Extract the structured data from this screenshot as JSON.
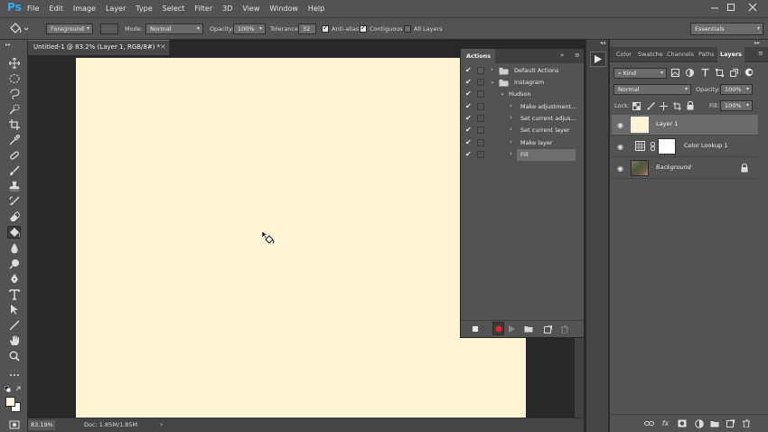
{
  "app": {
    "logo": "Ps",
    "menus": [
      "File",
      "Edit",
      "Image",
      "Layer",
      "Type",
      "Select",
      "Filter",
      "3D",
      "View",
      "Window",
      "Help"
    ]
  },
  "options": {
    "fill_source": "Foreground",
    "mode_label": "Mode:",
    "mode_value": "Normal",
    "opacity_label": "Opacity:",
    "opacity_value": "100%",
    "tolerance_label": "Tolerance:",
    "tolerance_value": "32",
    "antialias_label": "Anti-alias",
    "contiguous_label": "Contiguous",
    "all_layers_label": "All Layers",
    "workspace": "Essentials"
  },
  "document": {
    "tab_title": "Untitled-1 @ 83.2% (Layer 1, RGB/8#) *",
    "close_glyph": "×",
    "canvas_color": "#fff4d6",
    "zoom": "83.19%",
    "doc_size": "Doc: 1.85M/1.85M"
  },
  "actions_panel": {
    "title": "Actions",
    "rows": [
      {
        "name": "Default Actions",
        "level": 0,
        "kind": "set",
        "expanded": false
      },
      {
        "name": "Instagram",
        "level": 0,
        "kind": "set",
        "expanded": true
      },
      {
        "name": "Hudson",
        "level": 1,
        "kind": "action",
        "expanded": true
      },
      {
        "name": "Make adjustment...",
        "level": 2,
        "kind": "step"
      },
      {
        "name": "Set current adjus...",
        "level": 2,
        "kind": "step"
      },
      {
        "name": "Set current layer",
        "level": 2,
        "kind": "step"
      },
      {
        "name": "Make layer",
        "level": 2,
        "kind": "step"
      },
      {
        "name": "Fill",
        "level": 2,
        "kind": "step",
        "selected": true
      }
    ]
  },
  "layers_panel": {
    "tabs": [
      "Color",
      "Swatche",
      "Channels",
      "Paths",
      "Layers"
    ],
    "active_tab": "Layers",
    "filter_kind": "Kind",
    "blend_mode": "Normal",
    "opacity_label": "Opacity:",
    "opacity_value": "100%",
    "lock_label": "Lock:",
    "fill_label": "Fill:",
    "fill_value": "100%",
    "layers": [
      {
        "name": "Layer 1",
        "selected": true,
        "thumb_color": "#fff4d6"
      },
      {
        "name": "Color Lookup 1",
        "selected": false,
        "thumb_color": "#ffffff"
      },
      {
        "name": "Background",
        "selected": false,
        "locked": true,
        "thumb_color": "#6b5a4a"
      }
    ]
  },
  "colors": {
    "accent": "#31a8ff",
    "record": "#e0262b"
  }
}
